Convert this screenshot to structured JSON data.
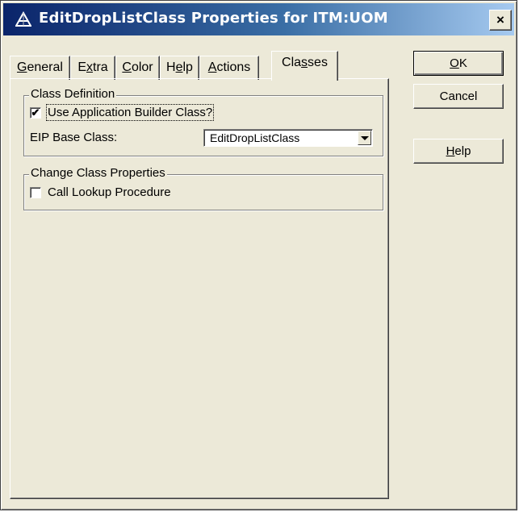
{
  "window": {
    "title": "EditDropListClass Properties for ITM:UOM",
    "close_glyph": "×"
  },
  "tabs": [
    {
      "label": "General",
      "mnemonic": "G",
      "rest": "eneral",
      "active": false
    },
    {
      "label": "Extra",
      "mnemonic": "x",
      "pre": "E",
      "rest": "tra",
      "active": false
    },
    {
      "label": "Color",
      "mnemonic": "C",
      "rest": "olor",
      "active": false
    },
    {
      "label": "Help",
      "mnemonic": "e",
      "pre": "H",
      "rest": "lp",
      "active": false
    },
    {
      "label": "Actions",
      "mnemonic": "A",
      "rest": "ctions",
      "active": false
    },
    {
      "label": "Classes",
      "mnemonic": "s",
      "pre": "Cla",
      "rest": "ses",
      "active": true
    }
  ],
  "class_definition": {
    "legend": "Class Definition",
    "use_app_builder_label": "Use Application Builder Class?",
    "use_app_builder_checked": true,
    "check_glyph": "✔",
    "eip_base_label": "EIP Base Class:",
    "eip_base_value": "EditDropListClass"
  },
  "change_class": {
    "legend": "Change Class Properties",
    "call_lookup_label": "Call Lookup Procedure",
    "call_lookup_checked": false
  },
  "buttons": {
    "ok": {
      "mnemonic": "O",
      "rest": "K"
    },
    "cancel": "Cancel",
    "help": {
      "mnemonic": "H",
      "rest": "elp"
    }
  }
}
